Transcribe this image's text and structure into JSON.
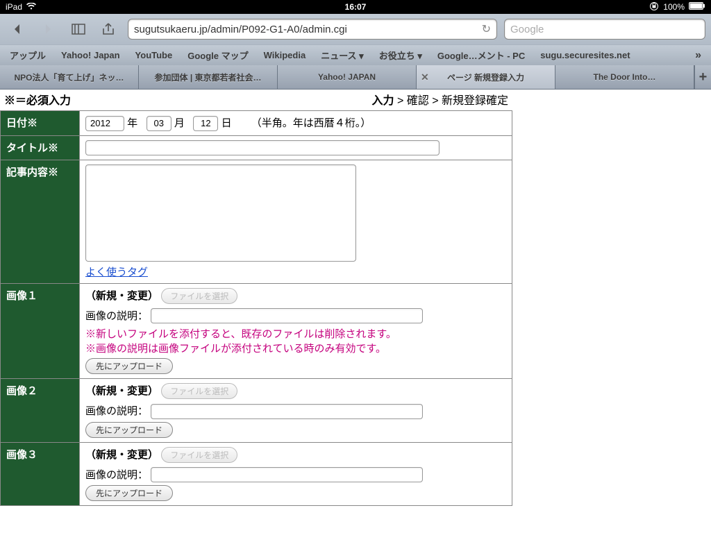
{
  "status": {
    "device": "iPad",
    "time": "16:07",
    "battery": "100%"
  },
  "toolbar": {
    "url": "sugutsukaeru.jp/admin/P092-G1-A0/admin.cgi",
    "search_placeholder": "Google"
  },
  "bookmarks": [
    "アップル",
    "Yahoo! Japan",
    "YouTube",
    "Google マップ",
    "Wikipedia",
    "ニュース ▾",
    "お役立ち ▾",
    "Google…メント - PC",
    "sugu.securesites.net"
  ],
  "tabs": [
    {
      "label": "NPO法人「育て上げ」ネッ…",
      "active": false,
      "closable": false
    },
    {
      "label": "参加団体 | 東京都若者社会…",
      "active": false,
      "closable": false
    },
    {
      "label": "Yahoo! JAPAN",
      "active": false,
      "closable": false
    },
    {
      "label": "ページ 新規登録入力",
      "active": true,
      "closable": true
    },
    {
      "label": "The Door Into…",
      "active": false,
      "closable": false
    }
  ],
  "page": {
    "required_note": "※＝必須入力",
    "breadcrumb": {
      "current": "入力",
      "sep": " > ",
      "rest": "確認 > 新規登録確定"
    },
    "rows": {
      "date": {
        "label": "日付",
        "req": "※",
        "year": "2012",
        "year_suffix": "年",
        "month": "03",
        "month_suffix": "月",
        "day": "12",
        "day_suffix": "日",
        "hint": "（半角。年は西暦４桁。）"
      },
      "title": {
        "label": "タイトル",
        "req": "※",
        "value": ""
      },
      "body": {
        "label": "記事内容",
        "req": "※",
        "value": "",
        "tag_link": "よく使うタグ"
      },
      "images": [
        {
          "label": "画像１",
          "mode": "（新規・変更）",
          "file_btn": "ファイルを選択",
          "desc_label": "画像の説明：",
          "desc_value": "",
          "note1": "※新しいファイルを添付すると、既存のファイルは削除されます。",
          "note2": "※画像の説明は画像ファイルが添付されている時のみ有効です。",
          "upload_btn": "先にアップロード"
        },
        {
          "label": "画像２",
          "mode": "（新規・変更）",
          "file_btn": "ファイルを選択",
          "desc_label": "画像の説明：",
          "desc_value": "",
          "upload_btn": "先にアップロード"
        },
        {
          "label": "画像３",
          "mode": "（新規・変更）",
          "file_btn": "ファイルを選択",
          "desc_label": "画像の説明：",
          "desc_value": "",
          "upload_btn": "先にアップロード"
        }
      ]
    }
  }
}
